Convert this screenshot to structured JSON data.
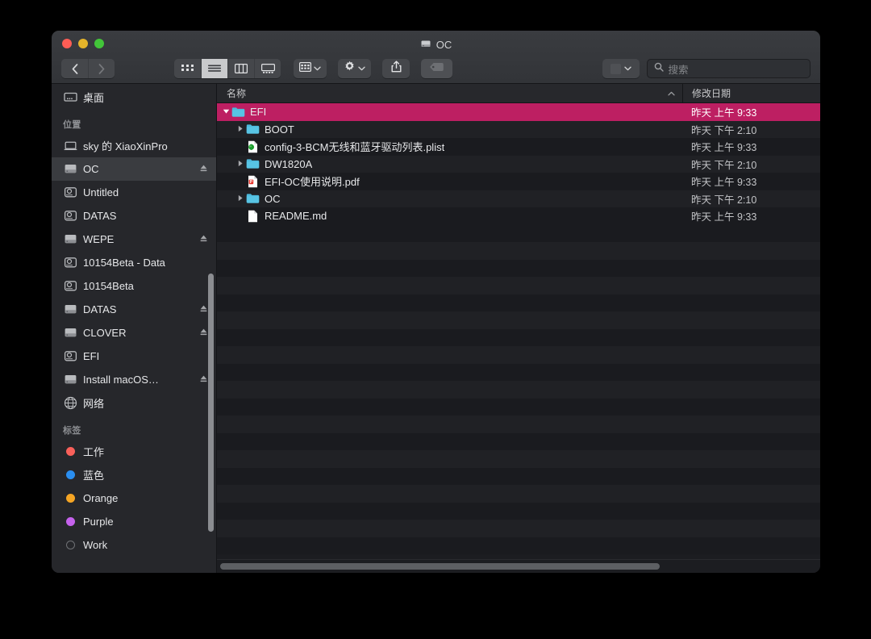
{
  "window": {
    "title": "OC",
    "title_icon": "hard-drive-icon",
    "traffic_lights": [
      "close",
      "minimize",
      "maximize"
    ]
  },
  "toolbar": {
    "back_label": "‹",
    "forward_label": "›",
    "view_modes": [
      {
        "name": "icon-view",
        "label": "⠀",
        "active": false
      },
      {
        "name": "list-view",
        "label": "⠀",
        "active": true
      },
      {
        "name": "column-view",
        "label": "⠀",
        "active": false
      },
      {
        "name": "gallery-view",
        "label": "⠀",
        "active": false
      }
    ],
    "group_button": "group-by-icon",
    "action_button": "gear-icon",
    "share_button": "share-icon",
    "tag_button": "tag-icon",
    "path_button": "path-icon",
    "chevron": "⌄"
  },
  "search": {
    "placeholder": "搜索",
    "icon": "search-icon",
    "value": ""
  },
  "sidebar": {
    "favorites": [
      {
        "label": "桌面",
        "icon": "desktop-icon",
        "eject": false,
        "selected": false
      }
    ],
    "sections": [
      {
        "title": "位置",
        "items": [
          {
            "label": "sky 的 XiaoXinPro",
            "icon": "laptop-icon",
            "eject": false,
            "selected": false
          },
          {
            "label": "OC",
            "icon": "drive-icon",
            "eject": true,
            "selected": true
          },
          {
            "label": "Untitled",
            "icon": "external-drive-icon",
            "eject": false,
            "selected": false
          },
          {
            "label": "DATAS",
            "icon": "external-drive-icon",
            "eject": false,
            "selected": false
          },
          {
            "label": "WEPE",
            "icon": "drive-icon",
            "eject": true,
            "selected": false
          },
          {
            "label": "10154Beta - Data",
            "icon": "external-drive-icon",
            "eject": false,
            "selected": false
          },
          {
            "label": "10154Beta",
            "icon": "external-drive-icon",
            "eject": false,
            "selected": false
          },
          {
            "label": "DATAS",
            "icon": "drive-icon",
            "eject": true,
            "selected": false
          },
          {
            "label": "CLOVER",
            "icon": "drive-icon",
            "eject": true,
            "selected": false
          },
          {
            "label": "EFI",
            "icon": "external-drive-icon",
            "eject": false,
            "selected": false
          },
          {
            "label": "Install macOS…",
            "icon": "drive-icon",
            "eject": true,
            "selected": false
          },
          {
            "label": "网络",
            "icon": "network-globe-icon",
            "eject": false,
            "selected": false
          }
        ]
      },
      {
        "title": "标签",
        "items": [
          {
            "label": "工作",
            "icon": "tag-dot-icon",
            "color": "#f9605a",
            "eject": false,
            "selected": false
          },
          {
            "label": "蓝色",
            "icon": "tag-dot-icon",
            "color": "#2a8ef0",
            "eject": false,
            "selected": false
          },
          {
            "label": "Orange",
            "icon": "tag-dot-icon",
            "color": "#f5a524",
            "eject": false,
            "selected": false
          },
          {
            "label": "Purple",
            "icon": "tag-dot-icon",
            "color": "#c562ec",
            "eject": false,
            "selected": false
          },
          {
            "label": "Work",
            "icon": "tag-dot-icon",
            "color": "",
            "eject": false,
            "selected": false
          }
        ]
      }
    ]
  },
  "filelist": {
    "columns": [
      {
        "key": "name",
        "label": "名称",
        "sort": "ascending",
        "sort_glyph": "⌃"
      },
      {
        "key": "date",
        "label": "修改日期"
      }
    ],
    "rows": [
      {
        "name": "EFI",
        "date": "昨天 上午 9:33",
        "icon": "folder-icon",
        "indent": 0,
        "disclosure": "expanded",
        "selected": true
      },
      {
        "name": "BOOT",
        "date": "昨天 下午 2:10",
        "icon": "folder-icon",
        "indent": 1,
        "disclosure": "collapsed",
        "selected": false
      },
      {
        "name": "config-3-BCM无线和蓝牙驱动列表.plist",
        "date": "昨天 上午 9:33",
        "icon": "plist-file-icon",
        "indent": 1,
        "disclosure": "none",
        "selected": false
      },
      {
        "name": "DW1820A",
        "date": "昨天 下午 2:10",
        "icon": "folder-icon",
        "indent": 1,
        "disclosure": "collapsed",
        "selected": false
      },
      {
        "name": "EFI-OC使用说明.pdf",
        "date": "昨天 上午 9:33",
        "icon": "pdf-file-icon",
        "indent": 1,
        "disclosure": "none",
        "selected": false
      },
      {
        "name": "OC",
        "date": "昨天 下午 2:10",
        "icon": "folder-icon",
        "indent": 1,
        "disclosure": "collapsed",
        "selected": false
      },
      {
        "name": "README.md",
        "date": "昨天 上午 9:33",
        "icon": "generic-file-icon",
        "indent": 1,
        "disclosure": "none",
        "selected": false
      }
    ],
    "empty_rows": 19
  },
  "colors": {
    "selection": "#bd1f62",
    "folder": "#4cb9dc",
    "window_bg": "#1c1d21",
    "sidebar_bg": "#26272b",
    "titlebar_bg": "#343639"
  }
}
